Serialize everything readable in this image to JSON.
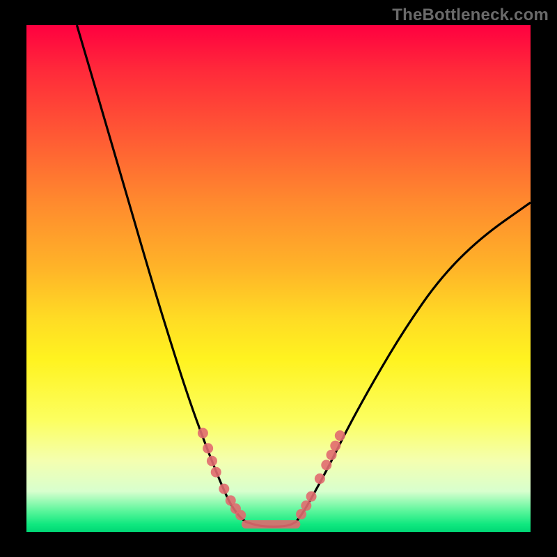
{
  "watermark": "TheBottleneck.com",
  "chart_data": {
    "type": "line",
    "title": "",
    "xlabel": "",
    "ylabel": "",
    "xlim": [
      0,
      100
    ],
    "ylim": [
      0,
      100
    ],
    "grid": false,
    "legend": false,
    "series": [
      {
        "name": "left-branch",
        "x": [
          10,
          18,
          25,
          30,
          33,
          36,
          38,
          39.5,
          40.5,
          41.5,
          42.5,
          43.5
        ],
        "y": [
          100,
          73,
          49,
          33,
          24,
          16,
          11,
          7.5,
          5.5,
          4,
          2.8,
          2
        ]
      },
      {
        "name": "trough",
        "x": [
          43.5,
          46,
          49,
          52,
          53.5
        ],
        "y": [
          2,
          1.2,
          1.0,
          1.2,
          2
        ]
      },
      {
        "name": "right-branch",
        "x": [
          53.5,
          55,
          57,
          60,
          64,
          69,
          75,
          82,
          90,
          100
        ],
        "y": [
          2,
          4,
          7.5,
          13,
          21,
          30,
          40,
          50,
          58,
          65
        ]
      }
    ],
    "markers": {
      "left_cluster": [
        {
          "x": 35.0,
          "y": 19.5
        },
        {
          "x": 36.0,
          "y": 16.5
        },
        {
          "x": 36.8,
          "y": 14.0
        },
        {
          "x": 37.6,
          "y": 11.8
        },
        {
          "x": 39.2,
          "y": 8.5
        },
        {
          "x": 40.5,
          "y": 6.2
        },
        {
          "x": 41.5,
          "y": 4.6
        },
        {
          "x": 42.5,
          "y": 3.3
        }
      ],
      "right_cluster": [
        {
          "x": 54.5,
          "y": 3.5
        },
        {
          "x": 55.5,
          "y": 5.2
        },
        {
          "x": 56.5,
          "y": 7.0
        },
        {
          "x": 58.2,
          "y": 10.5
        },
        {
          "x": 59.5,
          "y": 13.2
        },
        {
          "x": 60.5,
          "y": 15.2
        },
        {
          "x": 61.3,
          "y": 17.0
        },
        {
          "x": 62.2,
          "y": 19.0
        }
      ],
      "trough_bar": {
        "x0": 43.5,
        "x1": 53.5,
        "y": 1.5
      }
    },
    "colors": {
      "curve": "#000000",
      "markers": "#e16a6f",
      "background_top": "#ff0040",
      "background_bottom": "#00d775"
    }
  }
}
